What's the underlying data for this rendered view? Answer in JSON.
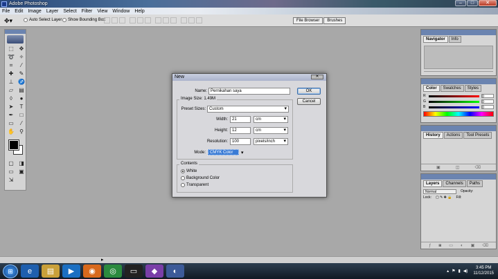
{
  "window": {
    "title": "Adobe Photoshop"
  },
  "menu": [
    "File",
    "Edit",
    "Image",
    "Layer",
    "Select",
    "Filter",
    "View",
    "Window",
    "Help"
  ],
  "options": {
    "auto_select_layer": "Auto Select Layer",
    "show_bounding_box": "Show Bounding Box",
    "tabs": [
      "File Browser",
      "Brushes"
    ]
  },
  "palettes": {
    "navigator_tabs": [
      "Navigator",
      "Info"
    ],
    "color_tabs": [
      "Color",
      "Swatches",
      "Styles"
    ],
    "color_labels": [
      "R",
      "G",
      "B"
    ],
    "color_values": [
      "0",
      "0",
      "0"
    ],
    "history_tabs": [
      "History",
      "Actions",
      "Tool Presets"
    ],
    "layers_tabs": [
      "Layers",
      "Channels",
      "Paths"
    ],
    "blend_mode": "Normal",
    "opacity_label": "Opacity:",
    "lock_label": "Lock:",
    "fill_label": "Fill:"
  },
  "dialog": {
    "title": "New",
    "name_label": "Name:",
    "name_value": "Pernikahan saya",
    "image_size": "Image Size: 1.49M",
    "preset_label": "Preset Sizes:",
    "preset_value": "Custom",
    "width_label": "Width:",
    "width_value": "21",
    "width_unit": "cm",
    "height_label": "Height:",
    "height_value": "12",
    "height_unit": "cm",
    "resolution_label": "Resolution:",
    "resolution_value": "100",
    "resolution_unit": "pixels/inch",
    "mode_label": "Mode:",
    "mode_value": "CMYK Color",
    "contents_label": "Contents",
    "contents_options": [
      "White",
      "Background Color",
      "Transparent"
    ],
    "ok": "OK",
    "cancel": "Cancel"
  },
  "status": {
    "zoom": ""
  },
  "taskbar": {
    "time": "3:45 PM",
    "date": "11/12/2015"
  }
}
